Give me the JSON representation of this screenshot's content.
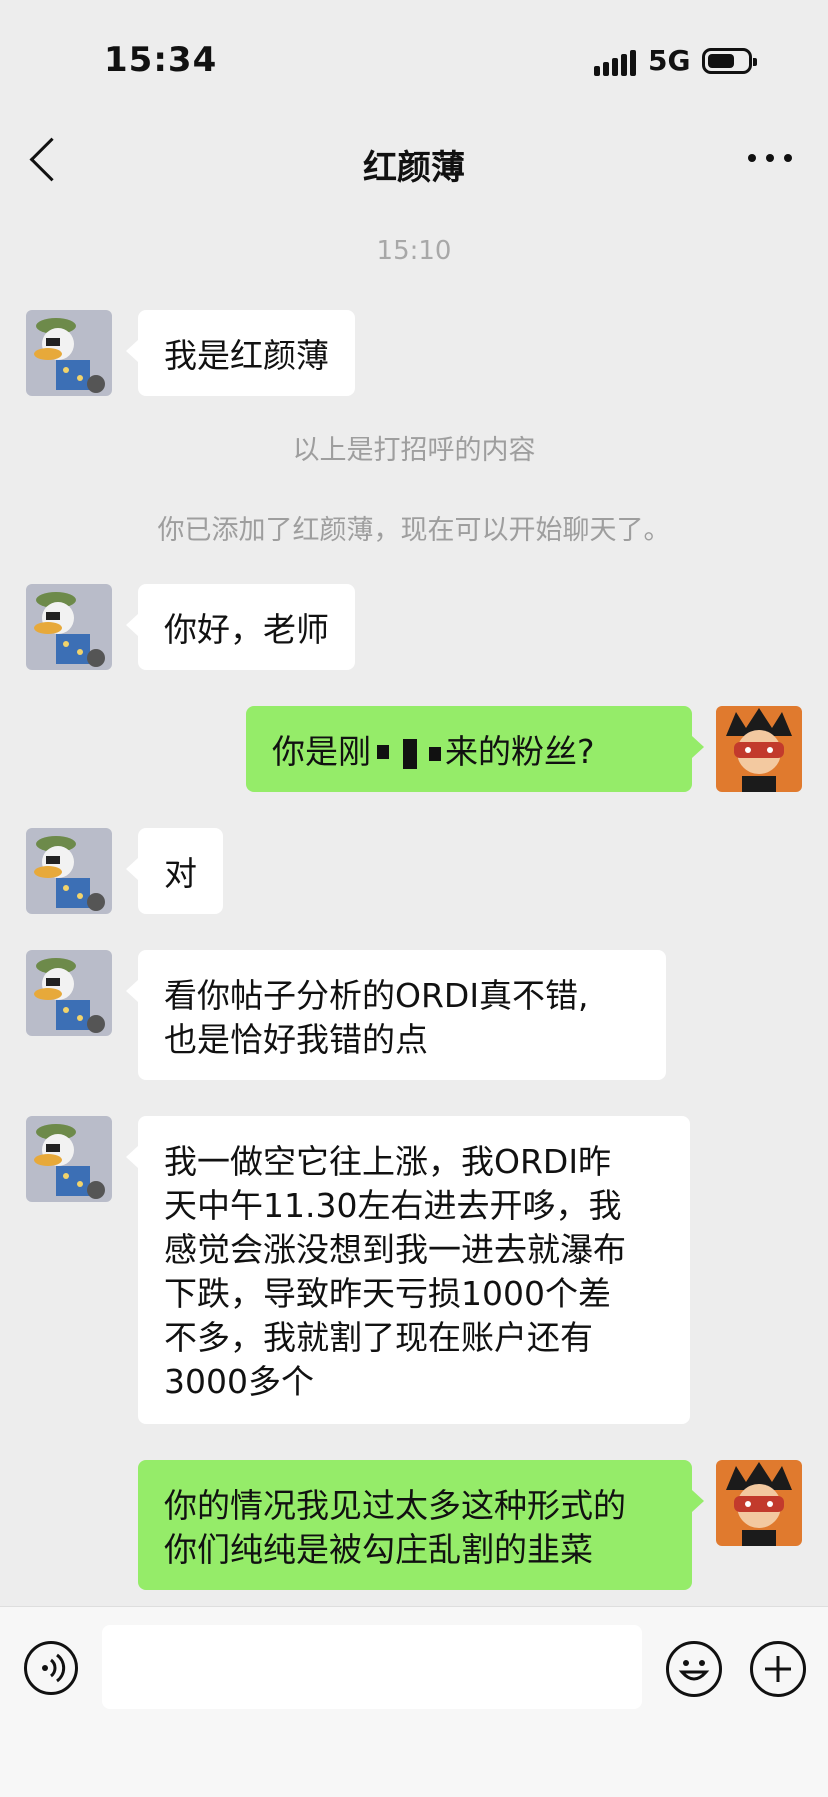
{
  "status_bar": {
    "time": "15:34",
    "network": "5G"
  },
  "header": {
    "title": "红颜薄"
  },
  "timestamp": "15:10",
  "system_notes": [
    "以上是打招呼的内容",
    "你已添加了红颜薄，现在可以开始聊天了。"
  ],
  "messages": [
    {
      "side": "in",
      "text": "我是红颜薄"
    },
    {
      "side": "in",
      "text": "你好，老师"
    },
    {
      "side": "out",
      "text_before": "你是刚",
      "text_after": "来的粉丝?",
      "redacted": true
    },
    {
      "side": "in",
      "text": "对"
    },
    {
      "side": "in",
      "lines": [
        "看你帖子分析的ORDI真不错,",
        "也是恰好我错的点"
      ]
    },
    {
      "side": "in",
      "lines": [
        "我一做空它往上涨，我ORDI昨",
        "天中午11.30左右进去开哆，我",
        "感觉会涨没想到我一进去就瀑布",
        "下跌，导致昨天亏损1000个差",
        "不多，我就割了现在账户还有",
        "3000多个"
      ]
    },
    {
      "side": "out",
      "lines": [
        "你的情况我见过太多这种形式的",
        "你们纯纯是被勾庄乱割的韭菜"
      ]
    }
  ],
  "colors": {
    "background": "#ededed",
    "incoming_bubble": "#ffffff",
    "outgoing_bubble": "#95ec69",
    "system_text": "#9e9e9e"
  },
  "icons": {
    "back": "chevron-left-icon",
    "more": "more-dots-icon",
    "voice": "voice-icon",
    "emoji": "emoji-icon",
    "plus": "plus-icon"
  }
}
